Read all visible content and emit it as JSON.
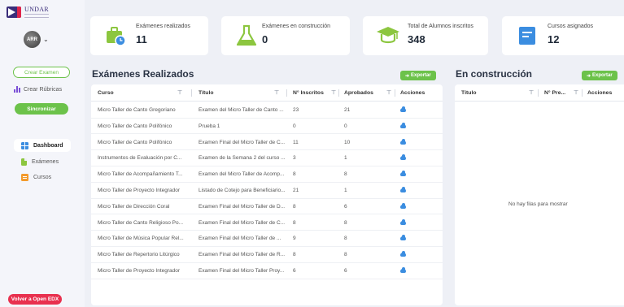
{
  "brand": {
    "name": "UNDAR"
  },
  "user": {
    "avatar_text": "ARR",
    "menu_chevron": "⌄"
  },
  "sidebar": {
    "create_exam": "Crear Examen",
    "create_rubrics": "Crear Rúbricas",
    "sync": "Sincronizar",
    "nav": [
      {
        "label": "Dashboard",
        "icon": "dashboard-icon",
        "active": true
      },
      {
        "label": "Exámenes",
        "icon": "document-icon",
        "active": false
      },
      {
        "label": "Cursos",
        "icon": "course-icon",
        "active": false
      }
    ],
    "back_button": "Volver a Open EDX"
  },
  "stats": [
    {
      "label": "Exámenes realizados",
      "value": "11",
      "icon": "exam-clock-icon"
    },
    {
      "label": "Exámenes en construcción",
      "value": "0",
      "icon": "flask-icon"
    },
    {
      "label": "Total de Alumnos inscritos",
      "value": "348",
      "icon": "graduation-cap-icon"
    },
    {
      "label": "Cursos asignados",
      "value": "12",
      "icon": "course-book-icon"
    }
  ],
  "completed": {
    "title": "Exámenes Realizados",
    "export_label": "Exportar",
    "columns": [
      "Curso",
      "Título",
      "N° Inscritos",
      "Aprobados",
      "Acciones"
    ],
    "rows": [
      {
        "course": "Micro Taller de Canto Gregoriano",
        "title": "Examen del Micro Taller de Canto ...",
        "enrolled": "23",
        "approved": "21"
      },
      {
        "course": "Micro Taller de Canto Polifónico",
        "title": "Prueba 1",
        "enrolled": "0",
        "approved": "0"
      },
      {
        "course": "Micro Taller de Canto Polifónico",
        "title": "Examen Final del Micro Taller de C...",
        "enrolled": "11",
        "approved": "10"
      },
      {
        "course": "Instrumentos de Evaluación por C...",
        "title": "Examen de la Semana 2 del curso ...",
        "enrolled": "3",
        "approved": "1"
      },
      {
        "course": "Micro Taller de Acompañamiento T...",
        "title": "Examen del Micro Taller de Acomp...",
        "enrolled": "8",
        "approved": "8"
      },
      {
        "course": "Micro Taller de Proyecto Integrador",
        "title": "Listado de Cotejo para Beneficiario...",
        "enrolled": "21",
        "approved": "1"
      },
      {
        "course": "Micro Taller de Dirección Coral",
        "title": "Examen Final del Micro Taller de D...",
        "enrolled": "8",
        "approved": "6"
      },
      {
        "course": "Micro Taller de Canto Religioso Po...",
        "title": "Examen Final del Micro Taller de C...",
        "enrolled": "8",
        "approved": "8"
      },
      {
        "course": "Micro Taller de Música Popular Rel...",
        "title": "Examen Final del Micro Taller de ...",
        "enrolled": "9",
        "approved": "8"
      },
      {
        "course": "Micro Taller de Repertorio Litúrgico",
        "title": "Examen Final del Micro Taller de R...",
        "enrolled": "8",
        "approved": "8"
      },
      {
        "course": "Micro Taller de Proyecto Integrador",
        "title": "Examen Final del Micro Taller Proy...",
        "enrolled": "6",
        "approved": "6"
      }
    ]
  },
  "in_progress": {
    "title": "En construcción",
    "export_label": "Exportar",
    "columns": [
      "Título",
      "N° Pre...",
      "Acciones"
    ],
    "empty_text": "No hay filas para mostrar"
  },
  "colors": {
    "green": "#6cc24a",
    "red": "#e8314f",
    "blue": "#3b8de0",
    "purple": "#3a2d7a"
  }
}
